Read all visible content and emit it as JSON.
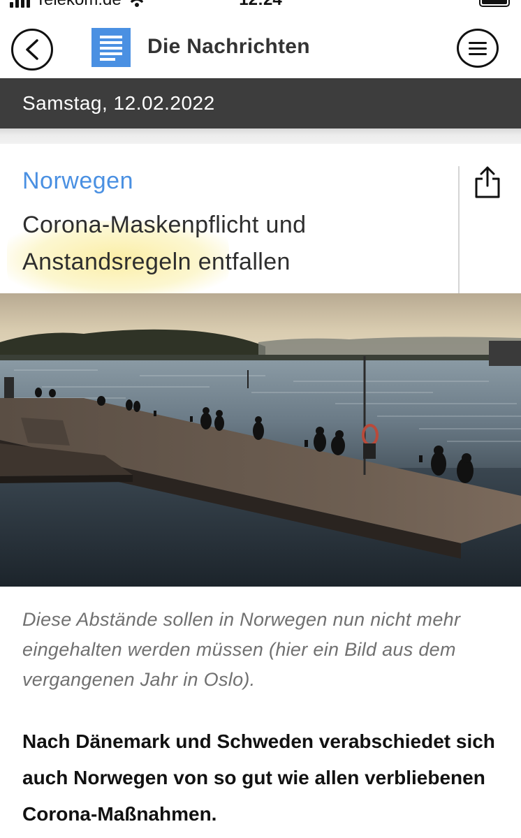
{
  "status_bar": {
    "carrier": "Telekom.de",
    "time": "12:24"
  },
  "header": {
    "app_title": "Die Nachrichten",
    "back_icon": "chevron-left-icon",
    "menu_icon": "hamburger-menu-icon",
    "logo_icon": "document-icon"
  },
  "date_bar": {
    "date": "Samstag, 12.02.2022"
  },
  "article": {
    "category": "Norwegen",
    "headline": "Corona-Maskenpflicht und Anstandsregeln entfallen",
    "share_icon": "share-icon",
    "image_caption": "Diese Abstände sollen in Norwegen nun nicht mehr eingehalten werden müssen (hier ein Bild aus dem vergangenen Jahr in Oslo).",
    "lead": "Nach Dänemark und Schweden verabschiedet sich auch Norwegen von so gut wie allen verbliebenen Corona-Maßnahmen."
  },
  "colors": {
    "accent": "#4a90e2",
    "date_bar_bg": "#3d3d3d",
    "text": "#2e2e2e",
    "caption": "#707070"
  }
}
